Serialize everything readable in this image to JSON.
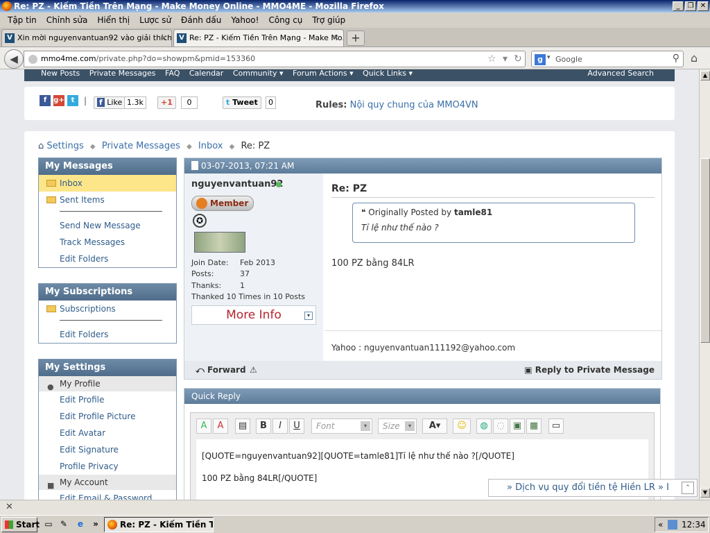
{
  "window": {
    "title": "Re: PZ - Kiếm Tiền Trên Mạng - Make Money Online - MMO4ME - Mozilla Firefox",
    "btn_min": "_",
    "btn_max": "❐",
    "btn_close": "✕"
  },
  "menu": [
    "Tập tin",
    "Chỉnh sửa",
    "Hiển thị",
    "Lược sử",
    "Đánh dấu",
    "Yahoo!",
    "Công cụ",
    "Trợ giúp"
  ],
  "tabs": [
    {
      "label": "Xin mời nguyenvantuan92 vào giải thích ..."
    },
    {
      "label": "Re: PZ - Kiếm Tiền Trên Mạng - Make Mo..."
    }
  ],
  "new_tab": "+",
  "tab_close": "✕",
  "nav": {
    "back": "◀",
    "url_host": "mmo4me.com",
    "url_path": "/private.php?do=showpm&pmid=153360",
    "star": "☆",
    "dropdown": "▾",
    "reload": "↻",
    "search_engine": "g",
    "search_placeholder": "Google",
    "search_icon": "⚲",
    "home": "⌂"
  },
  "topnav": {
    "items": [
      "New Posts",
      "Private Messages",
      "FAQ",
      "Calendar",
      "Community ▾",
      "Forum Actions ▾",
      "Quick Links ▾"
    ],
    "advanced": "Advanced Search"
  },
  "share": {
    "fb": "f",
    "gp": "g+",
    "tw": "t",
    "sep": "|",
    "like": "Like",
    "like_count": "1.3k",
    "plus": "+1",
    "plus_count": "0",
    "tweet": "Tweet",
    "tweet_count": "0",
    "rules_label": "Rules:",
    "rules_link": "Nội quy chung của MMO4VN"
  },
  "breadcrumb": [
    "Settings",
    "Private Messages",
    "Inbox"
  ],
  "breadcrumb_current": "Re: PZ",
  "breadcrumb_sep": "◆",
  "sidebar": {
    "messages": {
      "title": "My Messages",
      "inbox": "Inbox",
      "sent": "Sent Items",
      "links": [
        "Send New Message",
        "Track Messages",
        "Edit Folders"
      ]
    },
    "subscriptions": {
      "title": "My Subscriptions",
      "subs": "Subscriptions",
      "links": [
        "Edit Folders"
      ]
    },
    "settings": {
      "title": "My Settings",
      "profile_group": "My Profile",
      "profile_links": [
        "Edit Profile",
        "Edit Profile Picture",
        "Edit Avatar",
        "Edit Signature",
        "Profile Privacy"
      ],
      "account_group": "My Account",
      "account_links": [
        "Edit Email & Password"
      ]
    }
  },
  "message": {
    "date": "03-07-2013, 07:21 AM",
    "username": "nguyenvantuan92",
    "rank": "Member",
    "star": "✪",
    "join_label": "Join Date:",
    "join": "Feb 2013",
    "posts_label": "Posts:",
    "posts": "37",
    "thanks_label": "Thanks:",
    "thanks": "1",
    "thanked": "Thanked 10 Times in 10 Posts",
    "more_info": "More Info",
    "more_icon": "▾",
    "title": "Re: PZ",
    "quote_prefix": "❝ Originally Posted by",
    "quote_author": "tamle81",
    "quote_text": "Tỉ lệ như thế nào ?",
    "text": "100 PZ bằng 84LR",
    "signature": "Yahoo : nguyenvantuan111192@yahoo.com",
    "forward": "⤺ Forward",
    "warn_icon": "⚠",
    "reply": "Reply to Private Message"
  },
  "quick_reply": {
    "title": "Quick Reply",
    "font": "Font",
    "size": "Size",
    "dd": "▾",
    "tb": {
      "format1": "A",
      "format2": "A",
      "paste": "▤",
      "bold": "B",
      "italic": "I",
      "underline": "U",
      "color": "A▾",
      "smile": "☺",
      "link": "◍",
      "unlink": "◌",
      "image": "▣",
      "video": "▦",
      "quote": "▭"
    },
    "line1": "[QUOTE=nguyenvantuan92][QUOTE=tamle81]Tỉ lệ như thế nào ?[/QUOTE]",
    "line2": "100 PZ bằng 84LR[/QUOTE]"
  },
  "floatbar": {
    "text": "» Dịch vụ quy đổi tiền tệ Hiền LR   » I",
    "up": "⌃"
  },
  "scroll": {
    "up": "▲",
    "down": "▼"
  },
  "addon_close": "✕",
  "taskbar": {
    "start": "Start",
    "item": "Re: PZ - Kiếm Tiền Trê...",
    "tray_arrow": "«",
    "clock": "12:34",
    "ql_more": "»",
    "ql1": "▭",
    "ql2": "✎",
    "ql3": "e"
  }
}
